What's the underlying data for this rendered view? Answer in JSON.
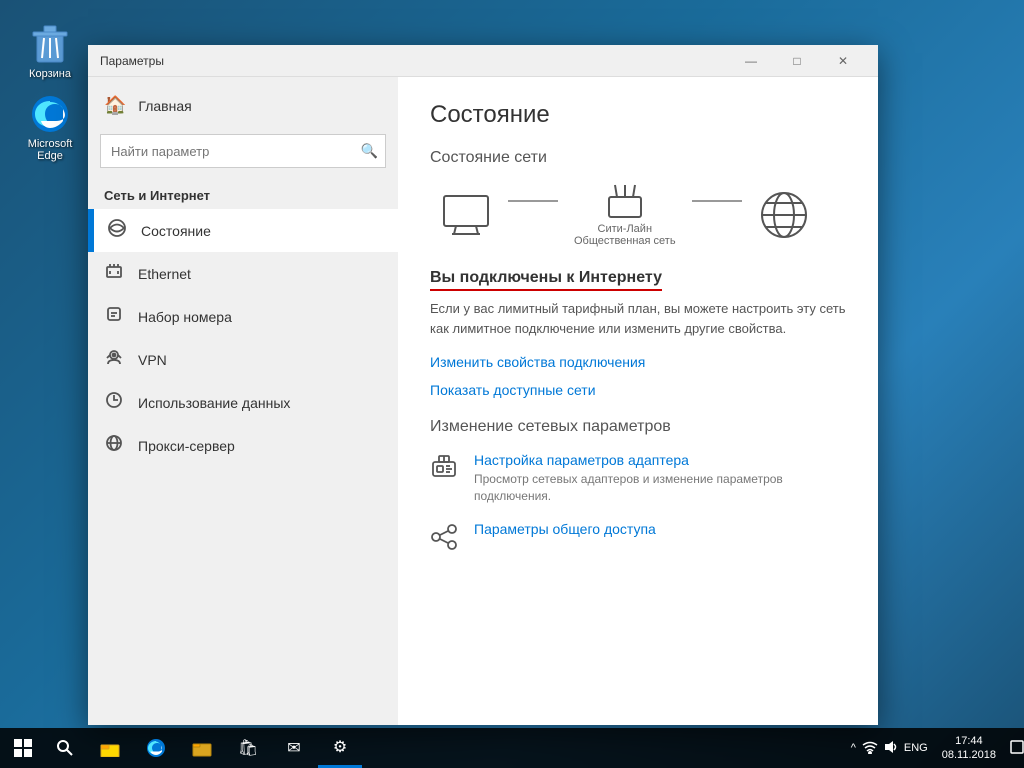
{
  "desktop": {
    "icons": [
      {
        "id": "recycle-bin",
        "label": "Корзина"
      },
      {
        "id": "edge",
        "label": "Microsoft\nEdge"
      }
    ]
  },
  "taskbar": {
    "start_label": "⊞",
    "search_label": "🔍",
    "items": [
      {
        "id": "file-explorer",
        "icon": "📁"
      },
      {
        "id": "edge-taskbar",
        "icon": "e"
      },
      {
        "id": "folder-taskbar",
        "icon": "📂"
      },
      {
        "id": "store",
        "icon": "🛍"
      },
      {
        "id": "mail",
        "icon": "✉"
      },
      {
        "id": "settings",
        "icon": "⚙"
      }
    ],
    "tray": {
      "chevron": "^",
      "network": "🌐",
      "volume": "🔊",
      "lang": "ENG",
      "time": "17:44",
      "date": "08.11.2018",
      "notification": "💬"
    }
  },
  "window": {
    "title": "Параметры",
    "controls": {
      "minimize": "—",
      "maximize": "□",
      "close": "✕"
    }
  },
  "sidebar": {
    "home_label": "Главная",
    "search_placeholder": "Найти параметр",
    "section_title": "Сеть и Интернет",
    "items": [
      {
        "id": "status",
        "label": "Состояние",
        "active": true
      },
      {
        "id": "ethernet",
        "label": "Ethernet"
      },
      {
        "id": "dialup",
        "label": "Набор номера"
      },
      {
        "id": "vpn",
        "label": "VPN"
      },
      {
        "id": "data-usage",
        "label": "Использование данных"
      },
      {
        "id": "proxy",
        "label": "Прокси-сервер"
      }
    ]
  },
  "main": {
    "page_title": "Состояние",
    "network_status_title": "Состояние сети",
    "network": {
      "device_label": "",
      "router_label": "Сити-Лайн\nОбщественная сеть",
      "internet_label": ""
    },
    "connected_title": "Вы подключены к Интернету",
    "connected_desc": "Если у вас лимитный тарифный план, вы можете настроить эту сеть как лимитное подключение или изменить другие свойства.",
    "link1": "Изменить свойства подключения",
    "link2": "Показать доступные сети",
    "change_settings_title": "Изменение сетевых параметров",
    "settings_items": [
      {
        "id": "adapter",
        "title": "Настройка параметров адаптера",
        "desc": "Просмотр сетевых адаптеров и изменение параметров подключения."
      },
      {
        "id": "sharing",
        "title": "Параметры общего доступа",
        "desc": ""
      }
    ]
  }
}
